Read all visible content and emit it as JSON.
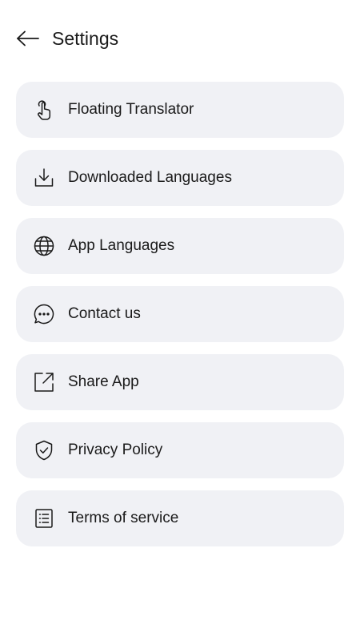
{
  "header": {
    "title": "Settings",
    "back_icon": "arrow-left-icon"
  },
  "settings": {
    "items": [
      {
        "label": "Floating Translator",
        "icon": "tap-finger-icon"
      },
      {
        "label": "Downloaded Languages",
        "icon": "download-icon"
      },
      {
        "label": "App Languages",
        "icon": "globe-icon"
      },
      {
        "label": "Contact us",
        "icon": "chat-bubble-icon"
      },
      {
        "label": "Share App",
        "icon": "share-external-icon"
      },
      {
        "label": "Privacy Policy",
        "icon": "shield-check-icon"
      },
      {
        "label": "Terms of service",
        "icon": "document-list-icon"
      }
    ]
  },
  "colors": {
    "background": "#ffffff",
    "item_background": "#f0f1f5",
    "text": "#1a1a1a"
  }
}
